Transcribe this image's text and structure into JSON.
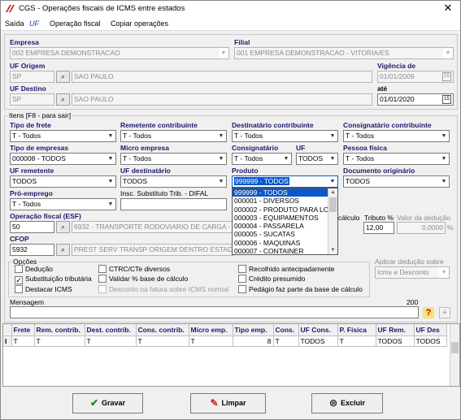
{
  "window": {
    "title": "CGS - Operações fiscais de ICMS entre estados",
    "close_glyph": "✕"
  },
  "menu": {
    "items": [
      "Saída",
      "UF",
      "Operação fiscal",
      "Copiar operações"
    ]
  },
  "header": {
    "empresa_label": "Empresa",
    "empresa_value": "002 EMPRESA DEMONSTRACAO",
    "filial_label": "Filial",
    "filial_value": "001 EMPRESA DEMONSTRACAO - VITORIA/ES",
    "uf_origem_label": "UF Origem",
    "uf_origem_code": "SP",
    "uf_origem_name": "SAO PAULO",
    "vigencia_label": "Vigência de",
    "vigencia_de": "01/01/2009",
    "uf_destino_label": "UF Destino",
    "uf_destino_code": "SP",
    "uf_destino_name": "SAO PAULO",
    "ate_label": "até",
    "ate_value": "01/01/2020"
  },
  "itens": {
    "group_title": "Itens [F8 - para sair]",
    "tipo_frete_label": "Tipo de frete",
    "tipo_frete_value": "T - Todos",
    "remetente_contrib_label": "Remetente contribuinte",
    "remetente_contrib_value": "T - Todos",
    "destinatario_contrib_label": "Destinatário contribuinte",
    "destinatario_contrib_value": "T - Todos",
    "consignatario_contrib_label": "Consignatário contribuinte",
    "consignatario_contrib_value": "T - Todos",
    "tipo_empresas_label": "Tipo de empresas",
    "tipo_empresas_value": "000008 - TODOS",
    "micro_empresa_label": "Micro empresa",
    "micro_empresa_value": "T - Todos",
    "consignatario_label": "Consignatário",
    "consignatario_value": "T - Todos",
    "uf_label": "UF",
    "uf_value": "TODOS",
    "pessoa_fisica_label": "Pessoa física",
    "pessoa_fisica_value": "T - Todos",
    "uf_remetente_label": "UF remetente",
    "uf_remetente_value": "TODOS",
    "uf_destinatario_label": "UF destinatário",
    "uf_destinatario_value": "TODOS",
    "produto_label": "Produto",
    "produto_value": "999999 - TODOS",
    "doc_originario_label": "Documento originário",
    "doc_originario_value": "TODOS",
    "pro_emprego_label": "Pró-emprego",
    "pro_emprego_value": "T - Todos",
    "insc_subst_label": "Insc. Substituto Trib. - DIFAL",
    "insc_subst_value": "",
    "operacao_fiscal_label": "Operação fiscal (ESF)",
    "operacao_fiscal_code": "50",
    "operacao_fiscal_desc": "6932 - TRANSPORTE RODOVIARIO DE CARGA - ",
    "calculo_label": "cálculo",
    "tributo_label": "Tributo %",
    "tributo_value": "12,00",
    "valor_deducao_label": "Valor da dedução",
    "valor_deducao_value": "0,0000",
    "percent_suffix": "%",
    "cfop_label": "CFOP",
    "cfop_code": "5932",
    "cfop_desc": "PREST SERV TRANSP ORIGEM DENTRO ESTAD"
  },
  "produto_dropdown": {
    "options": [
      "999999 - TODOS",
      "000001 - DIVERSOS",
      "000002 - PRODUTO PARA LO",
      "000003 - EQUIPAMENTOS",
      "000004 - PASSARELA",
      "000005 - SUCATAS",
      "000006 - MAQUINAS",
      "000007 - CONTAINER"
    ]
  },
  "opcoes": {
    "title": "Opções",
    "checkboxes": [
      {
        "label": "Dedução",
        "checked": false,
        "enabled": true
      },
      {
        "label": "Substituição tributária",
        "checked": true,
        "enabled": true
      },
      {
        "label": "Destacar ICMS",
        "checked": false,
        "enabled": true
      },
      {
        "label": "CTRC/CTe diversos",
        "checked": false,
        "enabled": true
      },
      {
        "label": "Validar % base de cálculo",
        "checked": false,
        "enabled": true
      },
      {
        "label": "Desconto na fatura sobre ICMS normal",
        "checked": false,
        "enabled": false
      },
      {
        "label": "Recolhido antecipadamente",
        "checked": false,
        "enabled": true
      },
      {
        "label": "Crédito presumido",
        "checked": false,
        "enabled": true
      },
      {
        "label": "Pedágio faz parte da base de cálculo",
        "checked": false,
        "enabled": true
      }
    ],
    "check_glyph": "✓"
  },
  "aplicar_deducao": {
    "label": "Aplicar dedução sobre",
    "value": "Icms e Desconto"
  },
  "mensagem": {
    "label": "Mensagem",
    "max": "200",
    "value": "",
    "help_glyph": "?",
    "add_glyph": "+"
  },
  "grid": {
    "columns": [
      "Frete",
      "Rem. contrib.",
      "Dest. contrib.",
      "Cons. contrib.",
      "Micro emp.",
      "Tipo emp.",
      "Cons.",
      "UF Cons.",
      "P. Física",
      "UF Rem.",
      "UF Des"
    ],
    "rows": [
      [
        "T",
        "T",
        "T",
        "T",
        "T",
        "8",
        "T",
        "TODOS",
        "T",
        "TODOS",
        "TODOS"
      ]
    ],
    "row_marker": "I"
  },
  "buttons": {
    "gravar": "Gravar",
    "limpar": "Limpar",
    "excluir": "Excluir"
  }
}
